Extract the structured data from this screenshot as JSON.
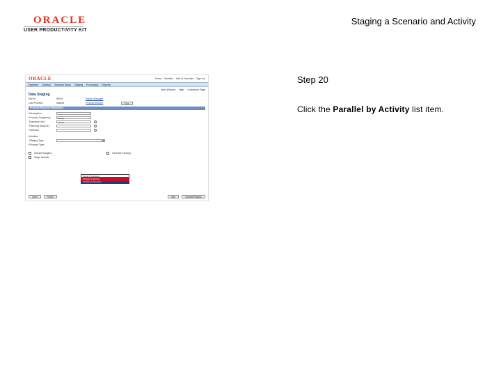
{
  "logo": {
    "brand": "ORACLE",
    "product": "USER PRODUCTIVITY KIT"
  },
  "slide_title": "Staging a Scenario and Activity",
  "step": "Step 20",
  "instruction": {
    "prefix": "Click the ",
    "target": "Parallel by Activity",
    "suffix": " list item."
  },
  "screenshot": {
    "logo": "ORACLE",
    "top_links": [
      "Home",
      "Worklist",
      "Add to Favorites",
      "Sign out"
    ],
    "nav": [
      "Organizer",
      "Develop",
      "Scenario Setup",
      "Staging",
      "Processing",
      "Reports"
    ],
    "util": [
      "New Window",
      "Help",
      "Customize Page"
    ],
    "page_heading": "Data Staging",
    "rows_top": [
      {
        "label": "Run ID",
        "value": "WS01",
        "link": "Report Manager"
      },
      {
        "label": "Last Process",
        "value": "Staged",
        "link": "Process Monitor"
      }
    ],
    "run_button": "Run",
    "section_title": "Process Request Parameters",
    "fields": [
      {
        "label": "*Description",
        "value": ""
      },
      {
        "label": "*Process Frequency",
        "value": "Always"
      },
      {
        "label": "*Business Unit",
        "value": "US003"
      },
      {
        "label": "*Planning Model ID",
        "value": ""
      },
      {
        "label": "*Scenario",
        "value": ""
      }
    ],
    "activities_label": "Activities",
    "staging_type_label": "*Staging Type",
    "process_type_label": "*Process Type",
    "dropdown": [
      {
        "text": "Single Processing",
        "state": "normal"
      },
      {
        "text": "Parallel by Activity",
        "state": "highlight"
      },
      {
        "text": "Parallel by Scenario",
        "state": "selected"
      }
    ],
    "checkboxes": [
      "Include Budgets",
      "Override Existing",
      "Stage Actuals"
    ],
    "footer_left": [
      "Save",
      "Notify"
    ],
    "footer_right": [
      "Add",
      "Update/Display"
    ]
  }
}
